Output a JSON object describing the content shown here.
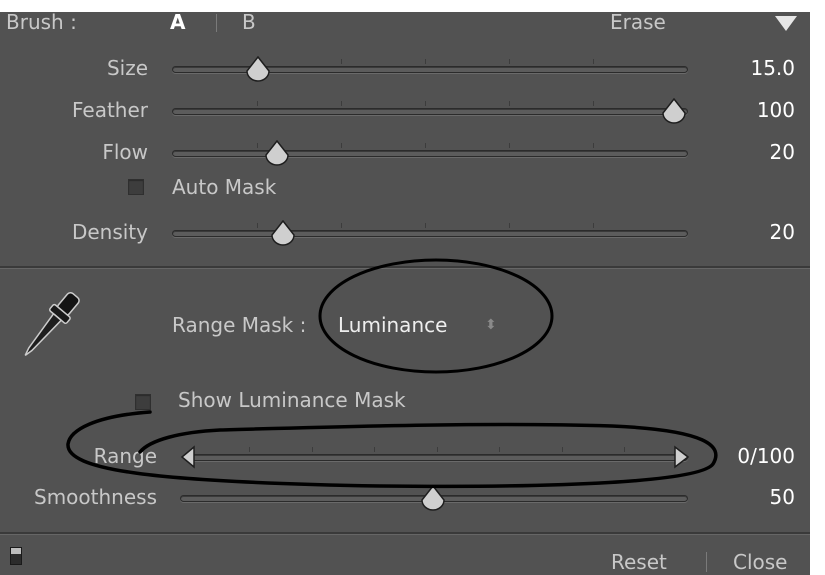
{
  "brush": {
    "label": "Brush :",
    "tab_a": "A",
    "tab_b": "B",
    "erase": "Erase"
  },
  "sliders": [
    {
      "label": "Size",
      "value": "15.0"
    },
    {
      "label": "Feather",
      "value": "100"
    },
    {
      "label": "Flow",
      "value": "20"
    },
    {
      "label": "Density",
      "value": "20"
    }
  ],
  "auto_mask": {
    "label": "Auto Mask",
    "checked": false
  },
  "range_mask": {
    "label": "Range Mask :",
    "selected": "Luminance",
    "show_mask_label": "Show Luminance Mask",
    "show_mask_checked": false
  },
  "range": {
    "label": "Range",
    "value": "0/100"
  },
  "smoothness": {
    "label": "Smoothness",
    "value": "50"
  },
  "footer": {
    "reset": "Reset",
    "close": "Close"
  },
  "annotations": {
    "stroke_color": "#000000"
  },
  "colors": {
    "panel_bg": "#525252",
    "text": "#c8c8c8",
    "value_text": "#ffffff"
  }
}
